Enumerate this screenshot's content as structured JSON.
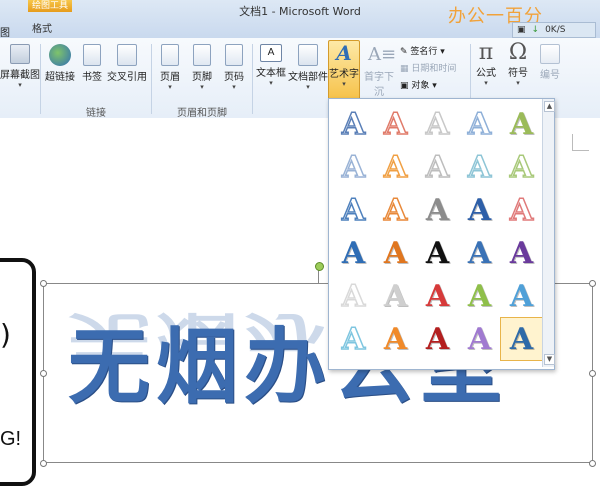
{
  "titlebar": {
    "context_tab": "绘图工具",
    "format_tab": "格式",
    "doc_title": "文档1 - Microsoft Word",
    "brand": "办公一百分",
    "net_speed": "0K/S"
  },
  "ribbon": {
    "left_cut_label": "图",
    "screenshot": "屏幕截图",
    "hyperlink": "超链接",
    "bookmark": "书签",
    "crossref": "交叉引用",
    "header": "页眉",
    "footer": "页脚",
    "pagenum": "页码",
    "textbox": "文本框",
    "quickparts": "文档部件",
    "wordart": "艺术字",
    "dropcap": "首字下沉",
    "signature": "签名行",
    "datetime": "日期和时间",
    "object": "对象",
    "equation": "公式",
    "symbol": "符号",
    "numbering": "编号",
    "group_links": "链接",
    "group_headerfooter": "页眉和页脚"
  },
  "document": {
    "wordart_text": "无烟办公室",
    "sign_text": "G!",
    "sign_circle": ")"
  },
  "gallery": {
    "glyph": "A",
    "styles": [
      {
        "color": "#5a7fb7",
        "style": "outline"
      },
      {
        "color": "#e07b6a",
        "style": "outline"
      },
      {
        "color": "#c8c8c8",
        "style": "outline"
      },
      {
        "color": "#8fb0d8",
        "style": "outline"
      },
      {
        "color": "#9bbb59",
        "style": "fill"
      },
      {
        "color": "#9ab3d6",
        "style": "outline"
      },
      {
        "color": "#f0a044",
        "style": "outline"
      },
      {
        "color": "#bdbdbd",
        "style": "outline"
      },
      {
        "color": "#8ec5d6",
        "style": "outline"
      },
      {
        "color": "#a9c97a",
        "style": "outline"
      },
      {
        "color": "#4f81bd",
        "style": "outline"
      },
      {
        "color": "#e8893a",
        "style": "outline"
      },
      {
        "color": "#8c8c8c",
        "style": "fill"
      },
      {
        "color": "#2e5fa8",
        "style": "fill"
      },
      {
        "color": "#e07a7a",
        "style": "outline"
      },
      {
        "color": "#2f6db5",
        "style": "fill"
      },
      {
        "color": "#e0761f",
        "style": "fill"
      },
      {
        "color": "#111111",
        "style": "fill"
      },
      {
        "color": "#3a72b6",
        "style": "fill"
      },
      {
        "color": "#6a3a9c",
        "style": "fill"
      },
      {
        "color": "#d9d9d9",
        "style": "outline"
      },
      {
        "color": "#cfcfcf",
        "style": "fill"
      },
      {
        "color": "#d63a3a",
        "style": "fill"
      },
      {
        "color": "#8fbf4a",
        "style": "fill"
      },
      {
        "color": "#4fa0d8",
        "style": "fill"
      },
      {
        "color": "#7fc6e0",
        "style": "outline"
      },
      {
        "color": "#f08a2a",
        "style": "fill"
      },
      {
        "color": "#b31f1f",
        "style": "fill"
      },
      {
        "color": "#a07ad0",
        "style": "fill"
      },
      {
        "color": "#2e6aa8",
        "style": "fill"
      }
    ]
  }
}
